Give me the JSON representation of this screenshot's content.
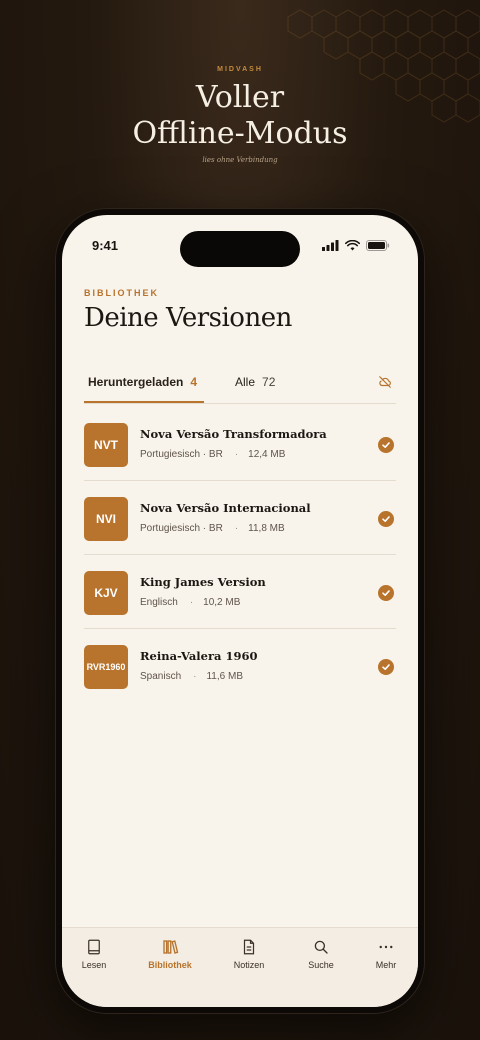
{
  "promo": {
    "brand": "MIDVASH",
    "headline_line1": "Voller",
    "headline_line2": "Offline-Modus",
    "tagline": "lies ohne Verbindung"
  },
  "status": {
    "time": "9:41"
  },
  "header": {
    "section_label": "BIBLIOTHEK",
    "title": "Deine Versionen"
  },
  "tabs": [
    {
      "label": "Heruntergeladen",
      "count": "4",
      "active": true
    },
    {
      "label": "Alle",
      "count": "72",
      "active": false
    }
  ],
  "versions": [
    {
      "abbr": "NVT",
      "name": "Nova Versão Transformadora",
      "lang": "Portugiesisch · BR",
      "size": "12,4 MB",
      "downloaded": true
    },
    {
      "abbr": "NVI",
      "name": "Nova Versão Internacional",
      "lang": "Portugiesisch · BR",
      "size": "11,8 MB",
      "downloaded": true
    },
    {
      "abbr": "KJV",
      "name": "King James Version",
      "lang": "Englisch",
      "size": "10,2 MB",
      "downloaded": true
    },
    {
      "abbr": "RVR1960",
      "name": "Reina-Valera 1960",
      "lang": "Spanisch",
      "size": "11,6 MB",
      "downloaded": true
    }
  ],
  "tabbar": [
    {
      "label": "Lesen",
      "icon": "book-icon",
      "active": false
    },
    {
      "label": "Bibliothek",
      "icon": "library-icon",
      "active": true
    },
    {
      "label": "Notizen",
      "icon": "notes-icon",
      "active": false
    },
    {
      "label": "Suche",
      "icon": "search-icon",
      "active": false
    },
    {
      "label": "Mehr",
      "icon": "more-icon",
      "active": false
    }
  ],
  "colors": {
    "accent": "#b8732c",
    "screen_bg": "#f8f4ec",
    "page_bg": "#24190f"
  }
}
